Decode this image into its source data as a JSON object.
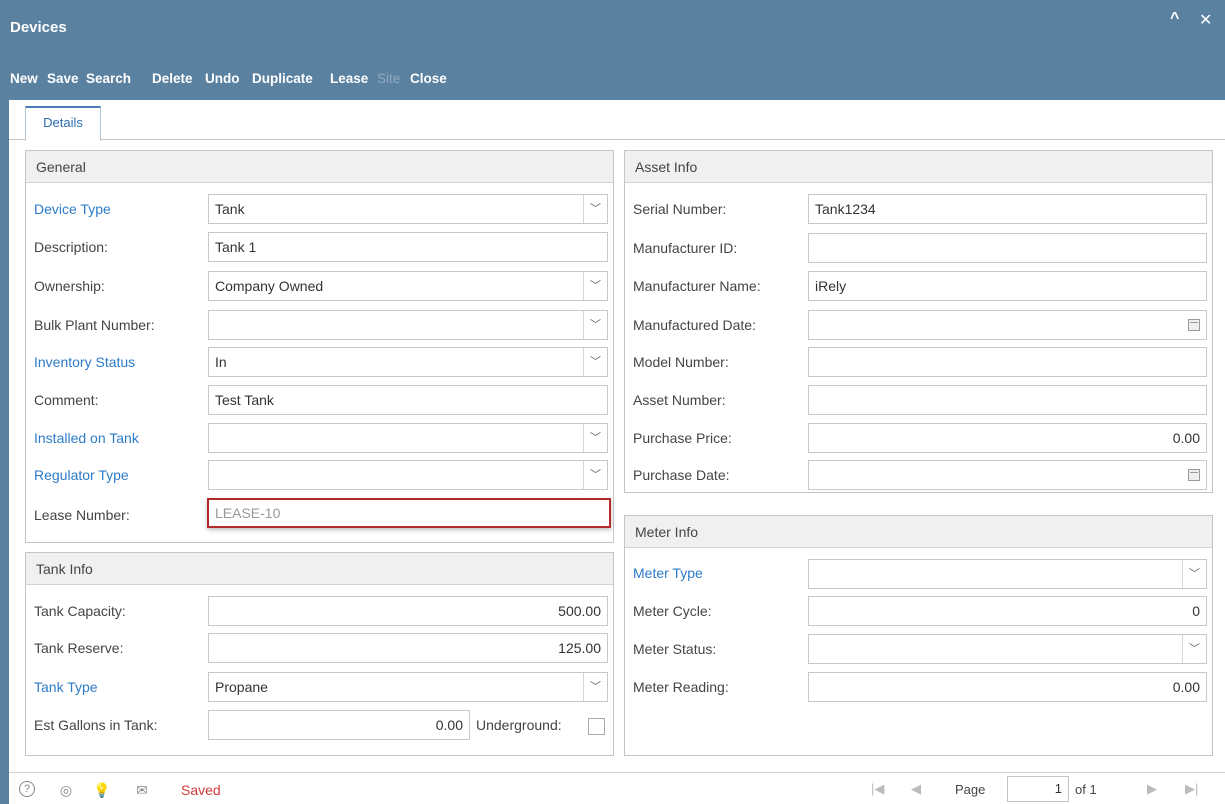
{
  "window": {
    "title": "Devices",
    "collapse_icon": "^",
    "close_icon": "✕"
  },
  "toolbar": {
    "new": "New",
    "save": "Save",
    "search": "Search",
    "delete": "Delete",
    "undo": "Undo",
    "duplicate": "Duplicate",
    "lease": "Lease",
    "site": "Site",
    "close": "Close"
  },
  "tabs": {
    "details": "Details"
  },
  "general": {
    "header": "General",
    "device_type_label": "Device Type",
    "device_type_value": "Tank",
    "description_label": "Description:",
    "description_value": "Tank 1",
    "ownership_label": "Ownership:",
    "ownership_value": "Company Owned",
    "bulk_plant_label": "Bulk Plant Number:",
    "bulk_plant_value": "",
    "inventory_status_label": "Inventory Status",
    "inventory_status_value": "In",
    "comment_label": "Comment:",
    "comment_value": "Test Tank",
    "installed_on_tank_label": "Installed on Tank",
    "installed_on_tank_value": "",
    "regulator_type_label": "Regulator Type",
    "regulator_type_value": "",
    "lease_number_label": "Lease Number:",
    "lease_number_value": "LEASE-10"
  },
  "tank_info": {
    "header": "Tank Info",
    "capacity_label": "Tank Capacity:",
    "capacity_value": "500.00",
    "reserve_label": "Tank Reserve:",
    "reserve_value": "125.00",
    "type_label": "Tank Type",
    "type_value": "Propane",
    "est_gallons_label": "Est Gallons in Tank:",
    "est_gallons_value": "0.00",
    "underground_label": "Underground:",
    "underground_checked": false
  },
  "asset_info": {
    "header": "Asset Info",
    "serial_label": "Serial Number:",
    "serial_value": "Tank1234",
    "manufacturer_id_label": "Manufacturer ID:",
    "manufacturer_id_value": "",
    "manufacturer_name_label": "Manufacturer Name:",
    "manufacturer_name_value": "iRely",
    "manufactured_date_label": "Manufactured Date:",
    "manufactured_date_value": "",
    "model_number_label": "Model Number:",
    "model_number_value": "",
    "asset_number_label": "Asset Number:",
    "asset_number_value": "",
    "purchase_price_label": "Purchase Price:",
    "purchase_price_value": "0.00",
    "purchase_date_label": "Purchase Date:",
    "purchase_date_value": ""
  },
  "meter_info": {
    "header": "Meter Info",
    "type_label": "Meter Type",
    "type_value": "",
    "cycle_label": "Meter Cycle:",
    "cycle_value": "0",
    "status_label": "Meter Status:",
    "status_value": "",
    "reading_label": "Meter Reading:",
    "reading_value": "0.00"
  },
  "statusbar": {
    "help_icon": "?",
    "support_icon": "◎",
    "idea_icon": "💡",
    "mail_icon": "✉",
    "status_text": "Saved",
    "page_label": "Page",
    "page_value": "1",
    "page_of": "of 1"
  },
  "colors": {
    "header_bar": "#5b81a1",
    "link_label": "#2d7bc8",
    "status_saved": "#d03b3b",
    "highlight_border": "#b22a2a"
  }
}
